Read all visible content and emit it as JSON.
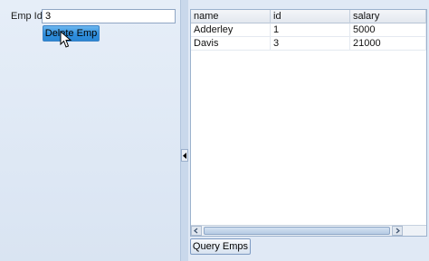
{
  "form": {
    "emp_id_label": "Emp Id",
    "emp_id_value": "3",
    "delete_button": "Delete Emp"
  },
  "table": {
    "columns": [
      "name",
      "id",
      "salary"
    ],
    "rows": [
      [
        "Adderley",
        "1",
        "5000"
      ],
      [
        "Davis",
        "3",
        "21000"
      ]
    ]
  },
  "query_button": "Query Emps",
  "icons": {
    "cursor": "pointer-arrow-icon",
    "splitter": "chevron-left-icon",
    "scroll_left": "chevron-left-icon",
    "scroll_right": "chevron-right-icon"
  },
  "colors": {
    "accent_button": "#2f8fde",
    "panel_bg": "#dbe6f4"
  }
}
